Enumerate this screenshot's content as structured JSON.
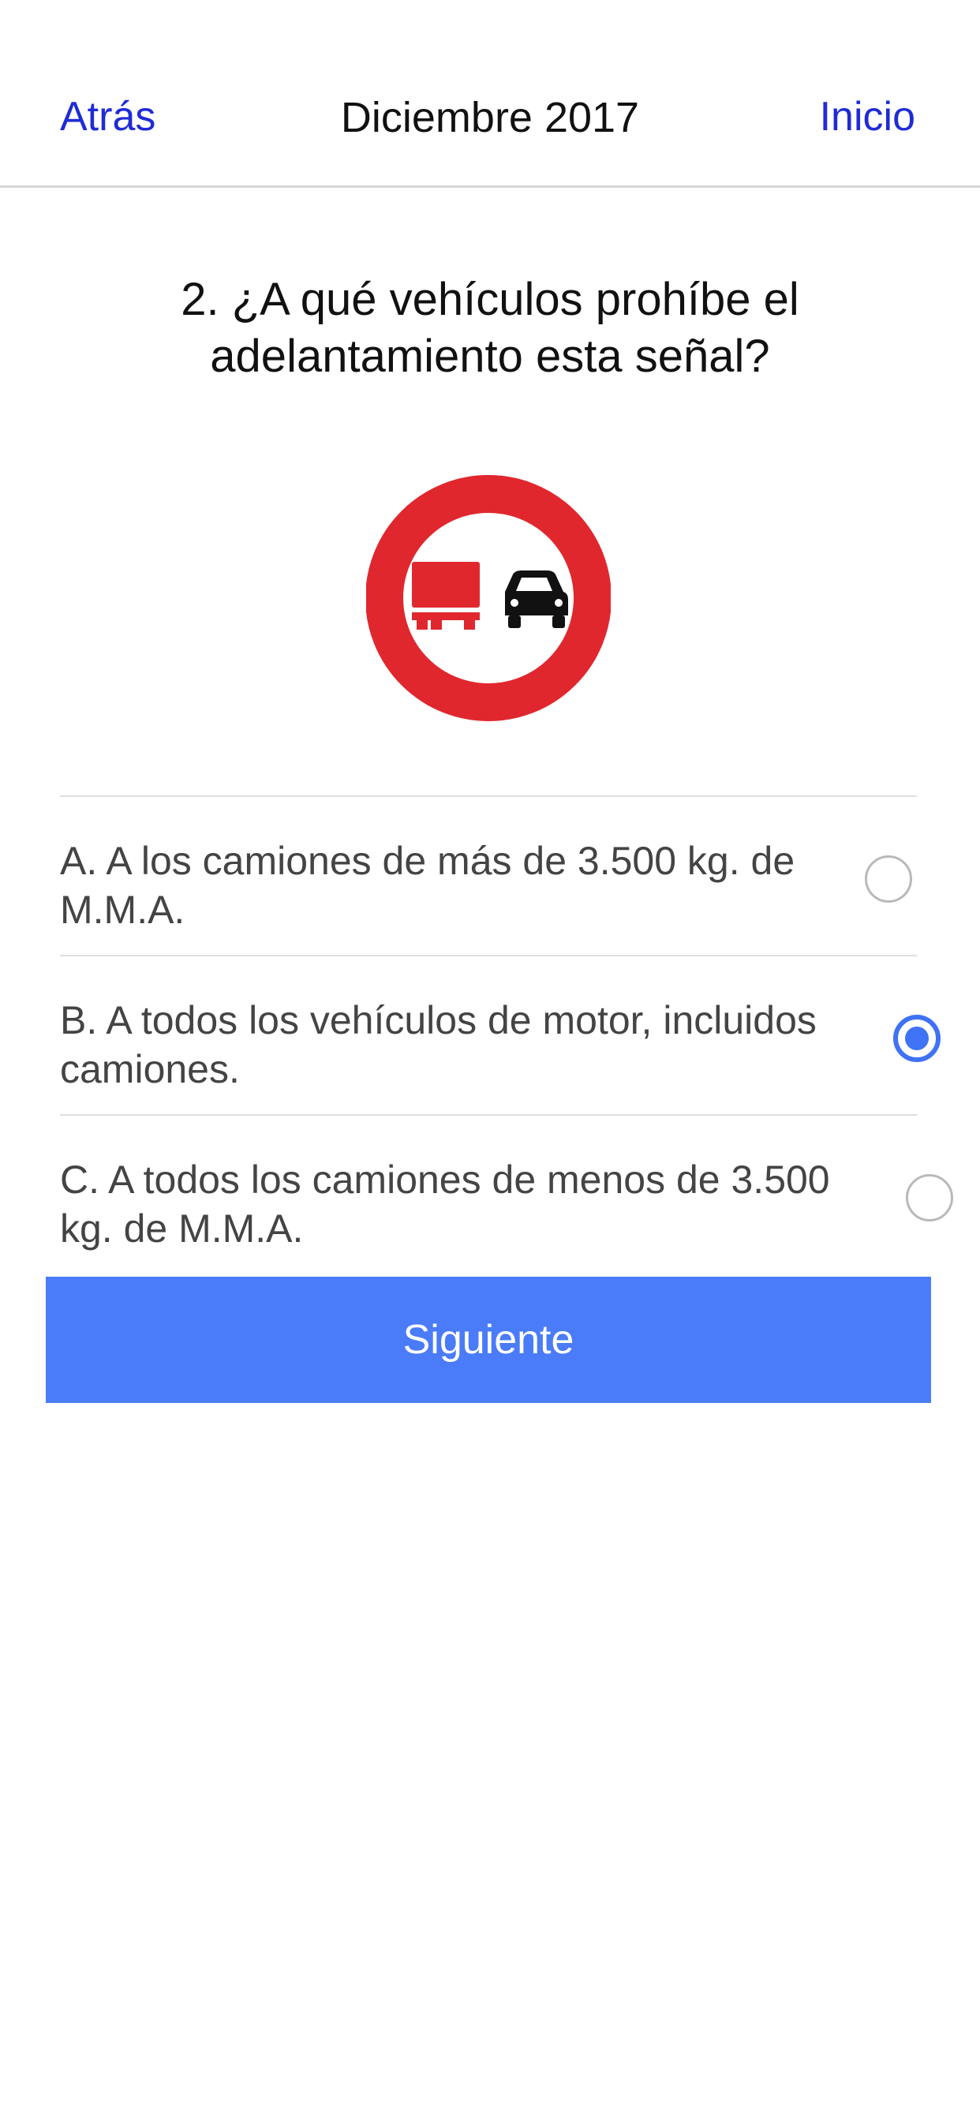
{
  "navbar": {
    "back_label": "Atrás",
    "title": "Diciembre 2017",
    "home_label": "Inicio"
  },
  "question": {
    "text": "2. ¿A qué vehículos prohíbe el adelantamiento esta señal?",
    "image_icon": "no-overtaking-trucks-sign"
  },
  "options": [
    {
      "label": "A. A los camiones de más de 3.500 kg. de M.M.A.",
      "selected": false
    },
    {
      "label": "B. A todos los vehículos de motor, incluidos camiones.",
      "selected": true
    },
    {
      "label": "C. A todos los camiones de menos de 3.500 kg. de M.M.A.",
      "selected": false
    }
  ],
  "next_button": {
    "label": "Siguiente"
  },
  "colors": {
    "nav_link": "#1f2bd6",
    "accent": "#4a7bf8",
    "radio_selected": "#3f72f5",
    "sign_red": "#e1272e"
  }
}
